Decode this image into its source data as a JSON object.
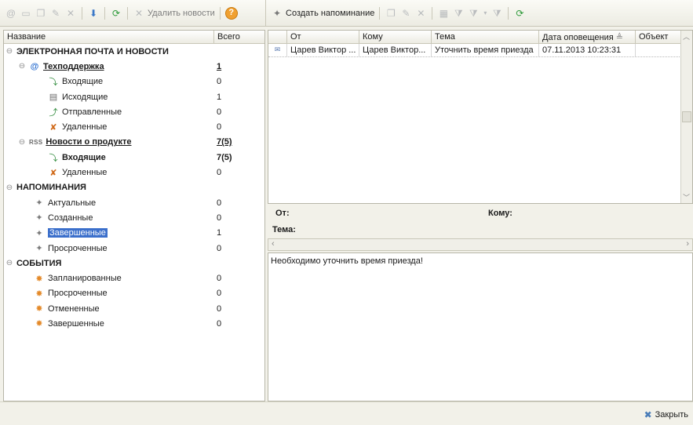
{
  "toolbar_left": {
    "delete_news_label": "Удалить новости",
    "help_glyph": "?"
  },
  "toolbar_right": {
    "create_reminder_label": "Создать напоминание"
  },
  "tree": {
    "col_name": "Название",
    "col_total": "Всего",
    "rows": [
      {
        "label": "ЭЛЕКТРОННАЯ ПОЧТА И НОВОСТИ",
        "count": ""
      },
      {
        "label": "Техподдержка",
        "count": "1"
      },
      {
        "label": "Входящие",
        "count": "0"
      },
      {
        "label": "Исходящие",
        "count": "1"
      },
      {
        "label": "Отправленные",
        "count": "0"
      },
      {
        "label": "Удаленные",
        "count": "0"
      },
      {
        "label": "Новости о продукте",
        "count": "7(5)",
        "badge": "RSS"
      },
      {
        "label": "Входящие",
        "count": "7(5)"
      },
      {
        "label": "Удаленные",
        "count": "0"
      },
      {
        "label": "НАПОМИНАНИЯ",
        "count": ""
      },
      {
        "label": "Актуальные",
        "count": "0"
      },
      {
        "label": "Созданные",
        "count": "0"
      },
      {
        "label": "Завершенные",
        "count": "1"
      },
      {
        "label": "Просроченные",
        "count": "0"
      },
      {
        "label": "СОБЫТИЯ",
        "count": ""
      },
      {
        "label": "Запланированные",
        "count": "0"
      },
      {
        "label": "Просроченные",
        "count": "0"
      },
      {
        "label": "Отмененные",
        "count": "0"
      },
      {
        "label": "Завершенные",
        "count": "0"
      }
    ]
  },
  "messages": {
    "headers": [
      "От",
      "Кому",
      "Тема",
      "Дата оповещения",
      "Объект"
    ],
    "sort_indicator": "≜",
    "rows": [
      {
        "from": "Царев Виктор ...",
        "to": "Царев Виктор...",
        "subject": "Уточнить время приезда",
        "date": "07.11.2013 10:23:31",
        "object": ""
      }
    ]
  },
  "preview": {
    "from_label": "От:",
    "to_label": "Кому:",
    "subject_label": "Тема:",
    "body": "Необходимо уточнить время приезда!"
  },
  "footer": {
    "close_label": "Закрыть"
  }
}
